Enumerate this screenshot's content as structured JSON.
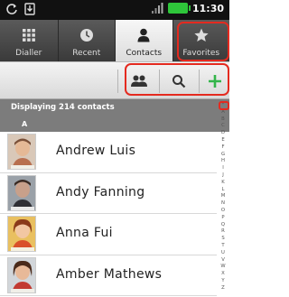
{
  "status_bar": {
    "time": "11:30",
    "icons": [
      "sync-icon",
      "download-icon",
      "signal-icon",
      "battery-icon"
    ]
  },
  "tabs": [
    {
      "label": "Dialler",
      "icon": "dialpad-icon",
      "active": false
    },
    {
      "label": "Recent",
      "icon": "clock-icon",
      "active": false
    },
    {
      "label": "Contacts",
      "icon": "person-icon",
      "active": true
    },
    {
      "label": "Favorites",
      "icon": "star-icon",
      "active": false
    }
  ],
  "action_bar": {
    "buttons": [
      "groups-icon",
      "search-icon",
      "add-contact-icon"
    ]
  },
  "contacts_header": {
    "count_text": "Displaying 214 contacts",
    "section_letter": "A"
  },
  "contacts": [
    {
      "name": "Andrew Luis"
    },
    {
      "name": "Andy Fanning"
    },
    {
      "name": "Anna Fui"
    },
    {
      "name": "Amber Mathews"
    }
  ],
  "alphabet_index": [
    "*",
    "A",
    "B",
    "C",
    "D",
    "E",
    "F",
    "G",
    "H",
    "I",
    "J",
    "K",
    "L",
    "M",
    "N",
    "O",
    "P",
    "Q",
    "R",
    "S",
    "T",
    "U",
    "V",
    "W",
    "X",
    "Y",
    "Z"
  ],
  "colors": {
    "accent_add": "#33b54a",
    "callout": "#e42a1f",
    "active_tab_bg": "#efefef",
    "header_bg": "#7c7c7c"
  }
}
